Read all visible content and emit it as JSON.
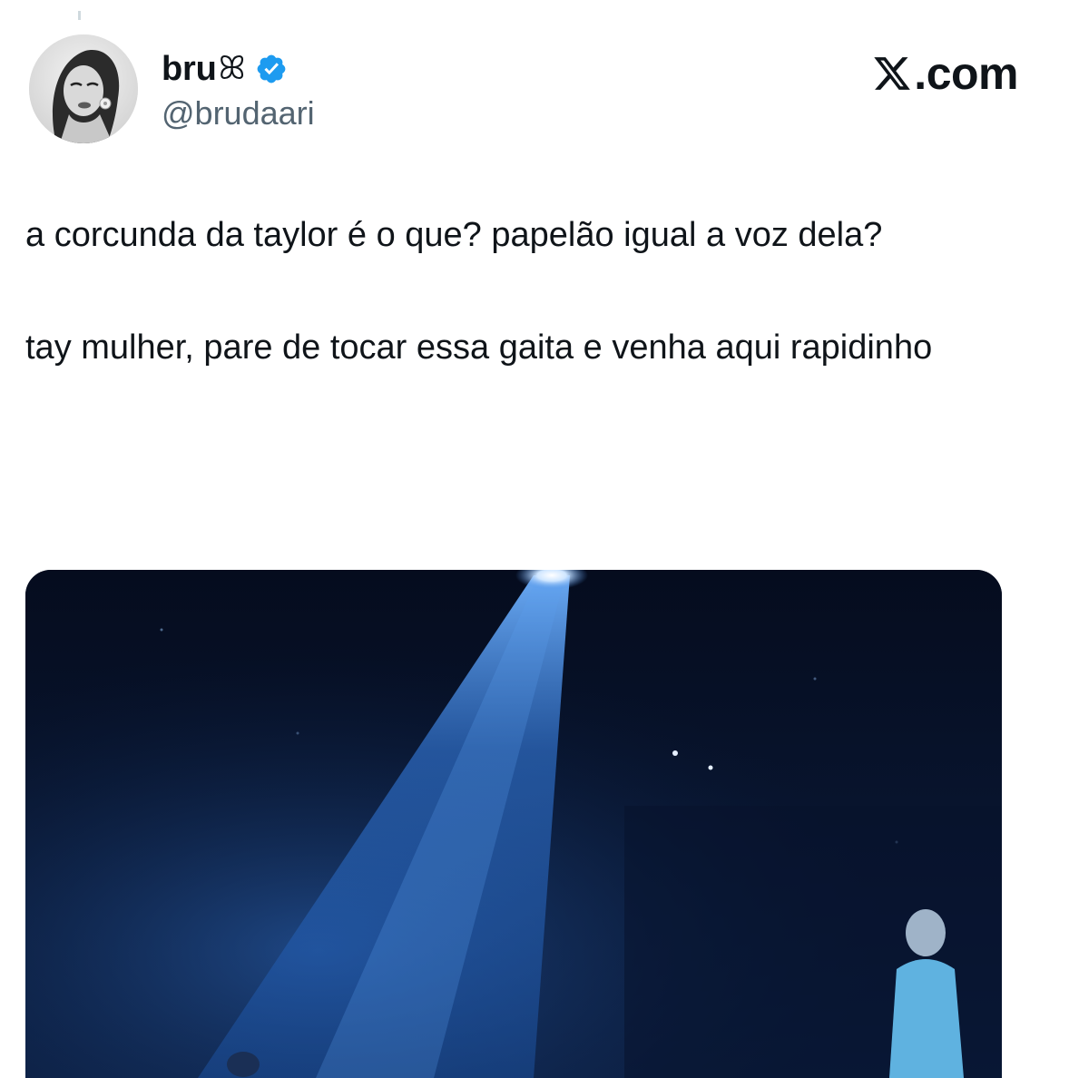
{
  "author": {
    "display_name": "bru",
    "name_glyph": "ꕤ",
    "verified": true,
    "verified_color": "#1d9bf0",
    "handle": "@brudaari",
    "avatar_icon": "avatar-photo"
  },
  "brand": {
    "label": ".com",
    "icon": "x-logo-icon"
  },
  "tweet": {
    "paragraphs": [
      "a corcunda da taylor é o que? papelão igual a voz dela?",
      "tay mulher, pare de tocar essa gaita e venha aqui rapidinho"
    ]
  },
  "media": {
    "type": "video-still",
    "description_icon": "concert-stage-image"
  },
  "colors": {
    "text": "#0f1419",
    "secondary": "#536471",
    "background": "#ffffff"
  }
}
